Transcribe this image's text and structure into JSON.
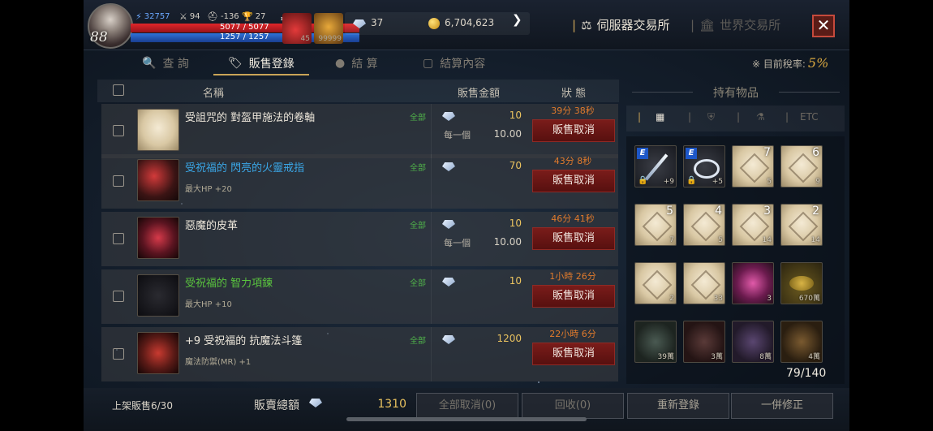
{
  "player": {
    "level": "88",
    "power": "32757",
    "attack": "94",
    "defense": "-136",
    "trophy": "27",
    "hp": "5077 / 5077",
    "mp": "1257 / 1257",
    "potion_count": "45",
    "item_count": "99999"
  },
  "currency": {
    "gems": "37",
    "gold": "6,704,623"
  },
  "exchange_tabs": {
    "server": "伺服器交易所",
    "world": "世界交易所"
  },
  "subtabs": {
    "search": "查 詢",
    "sell": "販售登錄",
    "settle": "結 算",
    "settle_detail": "結算內容"
  },
  "tax": {
    "label": "※ 目前稅率:",
    "value": "5%"
  },
  "list_header": {
    "name": "名稱",
    "price": "販售金額",
    "status": "狀 態"
  },
  "rows": [
    {
      "name": "受詛咒的 對盔甲施法的卷軸",
      "sub": "",
      "scope": "全部",
      "price": "10",
      "each_label": "每一個",
      "each_value": "10.00",
      "time": "39分 38秒",
      "cancel": "販售取消"
    },
    {
      "name": "受祝福的 閃亮的火靈戒指",
      "sub": "最大HP +20",
      "scope": "全部",
      "price": "70",
      "each_label": "",
      "each_value": "",
      "time": "43分 8秒",
      "cancel": "販售取消"
    },
    {
      "name": "惡魔的皮革",
      "sub": "",
      "scope": "全部",
      "price": "10",
      "each_label": "每一個",
      "each_value": "10.00",
      "time": "46分 41秒",
      "cancel": "販售取消"
    },
    {
      "name": "受祝福的 智力項鍊",
      "sub": "最大HP +10",
      "scope": "全部",
      "price": "10",
      "each_label": "",
      "each_value": "",
      "time": "1小時 26分",
      "cancel": "販售取消"
    },
    {
      "name": "+9 受祝福的 抗魔法斗篷",
      "sub": "魔法防禦(MR) +1",
      "scope": "全部",
      "price": "1200",
      "each_label": "",
      "each_value": "",
      "time": "22小時 6分",
      "cancel": "販售取消"
    }
  ],
  "inventory": {
    "title": "持有物品",
    "etc_tab": "ETC",
    "count": "79/140",
    "slots": [
      {
        "badge": "E",
        "enchant": "",
        "qty": "+9",
        "type": "weapon",
        "locked": true
      },
      {
        "badge": "E",
        "enchant": "",
        "qty": "+5",
        "type": "ring",
        "locked": true
      },
      {
        "badge": "",
        "enchant": "7",
        "qty": "5",
        "type": "scroll"
      },
      {
        "badge": "",
        "enchant": "6",
        "qty": "9",
        "type": "scroll"
      },
      {
        "badge": "",
        "enchant": "5",
        "qty": "7",
        "type": "scroll"
      },
      {
        "badge": "",
        "enchant": "4",
        "qty": "5",
        "type": "scroll"
      },
      {
        "badge": "",
        "enchant": "3",
        "qty": "14",
        "type": "scroll"
      },
      {
        "badge": "",
        "enchant": "2",
        "qty": "14",
        "type": "scroll"
      },
      {
        "badge": "",
        "enchant": "",
        "qty": "2",
        "type": "scroll"
      },
      {
        "badge": "",
        "enchant": "",
        "qty": "33",
        "type": "scroll"
      },
      {
        "badge": "",
        "enchant": "",
        "qty": "3",
        "type": "crystal"
      },
      {
        "badge": "",
        "enchant": "",
        "qty": "670萬",
        "type": "coins"
      },
      {
        "badge": "",
        "enchant": "",
        "qty": "39萬",
        "type": "orb-green"
      },
      {
        "badge": "",
        "enchant": "",
        "qty": "3萬",
        "type": "orb-red"
      },
      {
        "badge": "",
        "enchant": "",
        "qty": "8萬",
        "type": "orb-purple"
      },
      {
        "badge": "",
        "enchant": "",
        "qty": "4萬",
        "type": "orb-orange"
      }
    ]
  },
  "footer": {
    "listed": "上架販售6/30",
    "total_label": "販賣總額",
    "total_value": "1310",
    "cancel_all": "全部取消(0)",
    "reclaim": "回收(0)",
    "relist": "重新登錄",
    "modify": "一併修正"
  },
  "colors": {
    "accent_gold": "#c9a457",
    "price": "#e9c25f",
    "timer": "#e07a2c",
    "cancel_btn": "#7a1c1a",
    "scope_green": "#4fb04a",
    "blue_name": "#3aa6e6",
    "green_name": "#59c33e"
  }
}
